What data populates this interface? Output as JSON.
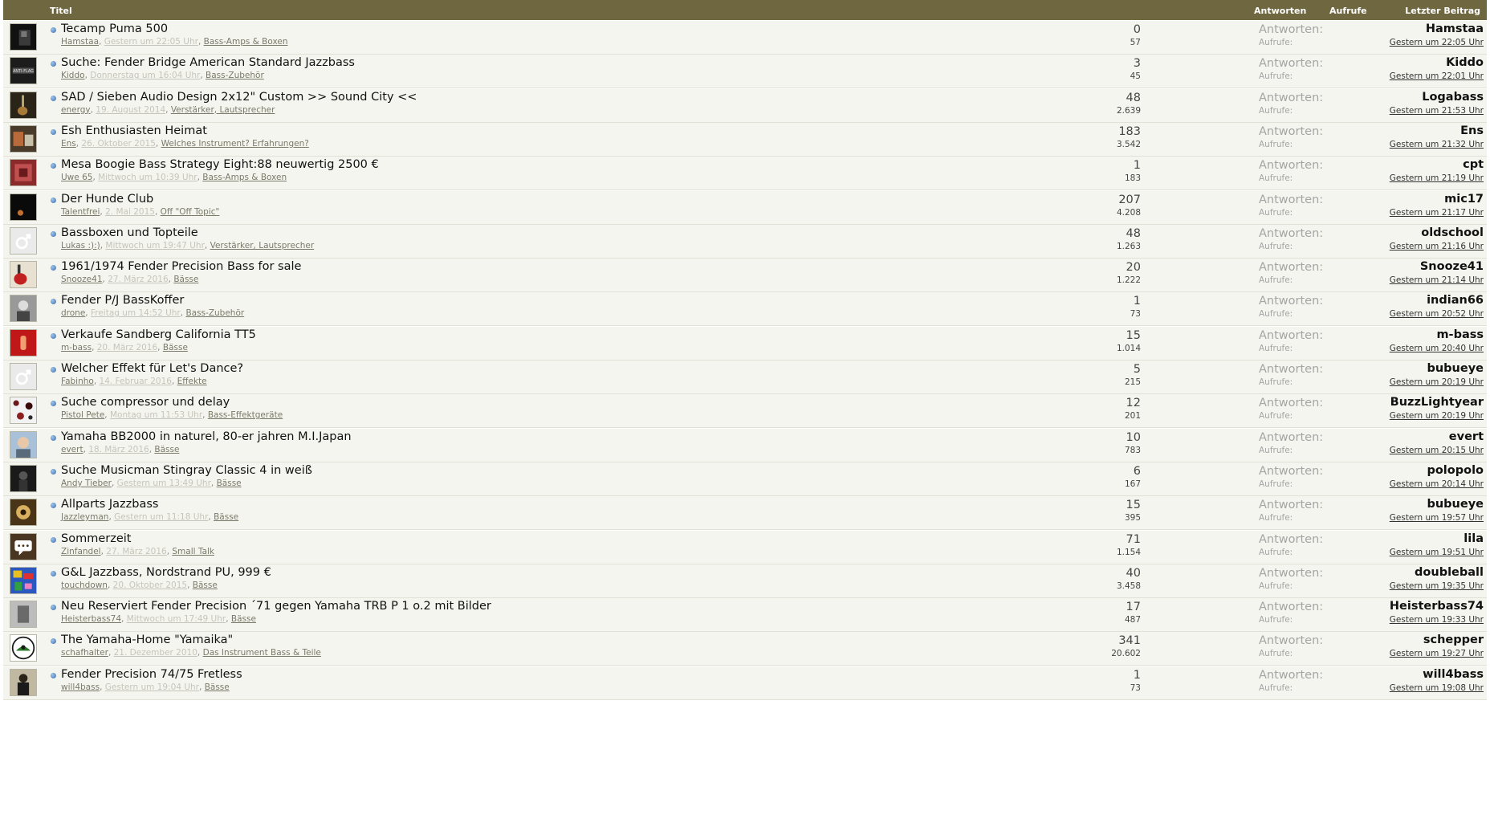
{
  "header": {
    "title_label": "Titel",
    "replies_label": "Antworten",
    "views_label": "Aufrufe",
    "last_post_label": "Letzter Beitrag"
  },
  "labels": {
    "replies": "Antworten:",
    "views": "Aufrufe:"
  },
  "threads": [
    {
      "title": "Tecamp Puma 500",
      "author": "Hamstaa",
      "date": "Gestern um 22:05 Uhr",
      "forum": "Bass-Amps & Boxen",
      "replies": "0",
      "views": "57",
      "last_user": "Hamstaa",
      "last_date": "Gestern um 22:05 Uhr",
      "avatar": "dark"
    },
    {
      "title": "Suche: Fender Bridge American Standard Jazzbass",
      "author": "Kiddo",
      "date": "Donnerstag um 16:04 Uhr",
      "forum": "Bass-Zubehör",
      "replies": "3",
      "views": "45",
      "last_user": "Kiddo",
      "last_date": "Gestern um 22:01 Uhr",
      "avatar": "antiflag"
    },
    {
      "title": "SAD / Sieben Audio Design 2x12\" Custom >> Sound City <<",
      "author": "energy",
      "date": "19. August 2014",
      "forum": "Verstärker, Lautsprecher",
      "replies": "48",
      "views": "2.639",
      "last_user": "Logabass",
      "last_date": "Gestern um 21:53 Uhr",
      "avatar": "guitar"
    },
    {
      "title": "Esh Enthusiasten Heimat",
      "author": "Ens",
      "date": "26. Oktober 2015",
      "forum": "Welches Instrument? Erfahrungen?",
      "replies": "183",
      "views": "3.542",
      "last_user": "Ens",
      "last_date": "Gestern um 21:32 Uhr",
      "avatar": "photo"
    },
    {
      "title": "Mesa Boogie Bass Strategy Eight:88 neuwertig 2500 €",
      "author": "Uwe 65",
      "date": "Mittwoch um 10:39 Uhr",
      "forum": "Bass-Amps & Boxen",
      "replies": "1",
      "views": "183",
      "last_user": "cpt",
      "last_date": "Gestern um 21:19 Uhr",
      "avatar": "red"
    },
    {
      "title": "Der Hunde Club",
      "author": "Talentfrei",
      "date": "2. Mai 2015",
      "forum": "Off \"Off Topic\"",
      "replies": "207",
      "views": "4.208",
      "last_user": "mic17",
      "last_date": "Gestern um 21:17 Uhr",
      "avatar": "black"
    },
    {
      "title": "Bassboxen und Topteile",
      "author": "Lukas :):)",
      "date": "Mittwoch um 19:47 Uhr",
      "forum": "Verstärker, Lautsprecher",
      "replies": "48",
      "views": "1.263",
      "last_user": "oldschool",
      "last_date": "Gestern um 21:16 Uhr",
      "avatar": "default"
    },
    {
      "title": "1961/1974 Fender Precision Bass for sale",
      "author": "Snooze41",
      "date": "27. März 2016",
      "forum": "Bässe",
      "replies": "20",
      "views": "1.222",
      "last_user": "Snooze41",
      "last_date": "Gestern um 21:14 Uhr",
      "avatar": "redbass"
    },
    {
      "title": "Fender P/J BassKoffer",
      "author": "drone",
      "date": "Freitag um 14:52 Uhr",
      "forum": "Bass-Zubehör",
      "replies": "1",
      "views": "73",
      "last_user": "indian66",
      "last_date": "Gestern um 20:52 Uhr",
      "avatar": "bw"
    },
    {
      "title": "Verkaufe Sandberg California TT5",
      "author": "m-bass",
      "date": "20. März 2016",
      "forum": "Bässe",
      "replies": "15",
      "views": "1.014",
      "last_user": "m-bass",
      "last_date": "Gestern um 20:40 Uhr",
      "avatar": "redhand"
    },
    {
      "title": "Welcher Effekt für Let's Dance?",
      "author": "Fabinho",
      "date": "14. Februar 2016",
      "forum": "Effekte",
      "replies": "5",
      "views": "215",
      "last_user": "bubueye",
      "last_date": "Gestern um 20:19 Uhr",
      "avatar": "default"
    },
    {
      "title": "Suche compressor und delay",
      "author": "Pistol Pete",
      "date": "Montag um 11:53 Uhr",
      "forum": "Bass-Effektgeräte",
      "replies": "12",
      "views": "201",
      "last_user": "BuzzLightyear",
      "last_date": "Gestern um 20:19 Uhr",
      "avatar": "pattern"
    },
    {
      "title": "Yamaha BB2000 in naturel, 80-er jahren M.I.Japan",
      "author": "evert",
      "date": "18. März 2016",
      "forum": "Bässe",
      "replies": "10",
      "views": "783",
      "last_user": "evert",
      "last_date": "Gestern um 20:15 Uhr",
      "avatar": "face"
    },
    {
      "title": "Suche Musicman Stingray Classic 4 in weiß",
      "author": "Andy Tieber",
      "date": "Gestern um 13:49 Uhr",
      "forum": "Bässe",
      "replies": "6",
      "views": "167",
      "last_user": "polopolo",
      "last_date": "Gestern um 20:14 Uhr",
      "avatar": "darkphoto"
    },
    {
      "title": "Allparts Jazzbass",
      "author": "Jazzleyman",
      "date": "Gestern um 11:18 Uhr",
      "forum": "Bässe",
      "replies": "15",
      "views": "395",
      "last_user": "bubueye",
      "last_date": "Gestern um 19:57 Uhr",
      "avatar": "brown"
    },
    {
      "title": "Sommerzeit",
      "author": "Zinfandel",
      "date": "27. März 2016",
      "forum": "Small Talk",
      "replies": "71",
      "views": "1.154",
      "last_user": "lila",
      "last_date": "Gestern um 19:51 Uhr",
      "avatar": "chat"
    },
    {
      "title": "G&L Jazzbass, Nordstrand PU, 999 €",
      "author": "touchdown",
      "date": "20. Oktober 2015",
      "forum": "Bässe",
      "replies": "40",
      "views": "3.458",
      "last_user": "doubleball",
      "last_date": "Gestern um 19:35 Uhr",
      "avatar": "colorful"
    },
    {
      "title": "Neu Reserviert Fender Precision ´71 gegen Yamaha TRB P 1 o.2 mit Bilder",
      "author": "Heisterbass74",
      "date": "Mittwoch um 17:49 Uhr",
      "forum": "Bässe",
      "replies": "17",
      "views": "487",
      "last_user": "Heisterbass74",
      "last_date": "Gestern um 19:33 Uhr",
      "avatar": "grey"
    },
    {
      "title": "The Yamaha-Home \"Yamaika\"",
      "author": "schafhalter",
      "date": "21. Dezember 2010",
      "forum": "Das Instrument Bass & Teile",
      "replies": "341",
      "views": "20.602",
      "last_user": "schepper",
      "last_date": "Gestern um 19:27 Uhr",
      "avatar": "logo"
    },
    {
      "title": "Fender Precision 74/75 Fretless",
      "author": "will4bass",
      "date": "Gestern um 19:04 Uhr",
      "forum": "Bässe",
      "replies": "1",
      "views": "73",
      "last_user": "will4bass",
      "last_date": "Gestern um 19:08 Uhr",
      "avatar": "person"
    }
  ]
}
